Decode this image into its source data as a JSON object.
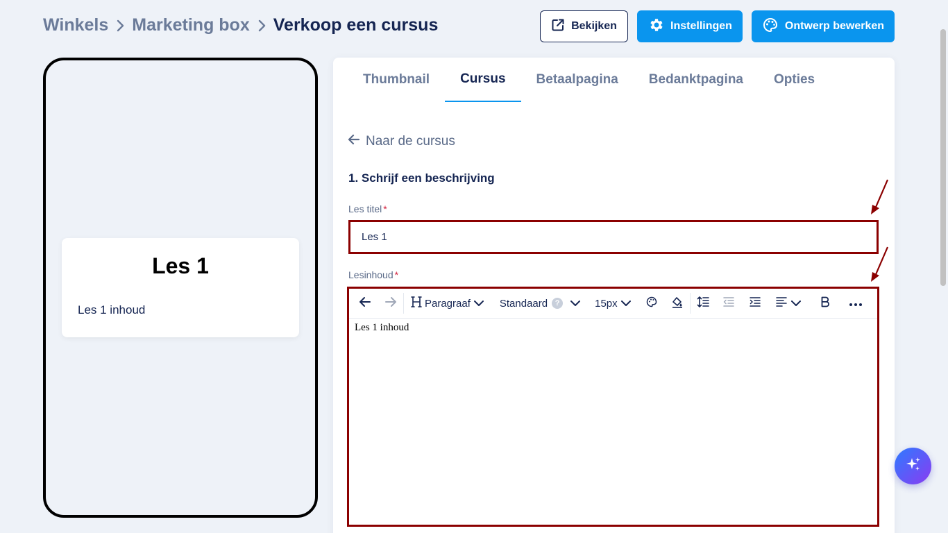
{
  "breadcrumb": {
    "items": [
      "Winkels",
      "Marketing box",
      "Verkoop een cursus"
    ]
  },
  "header": {
    "view_label": "Bekijken",
    "settings_label": "Instellingen",
    "design_label": "Ontwerp bewerken"
  },
  "preview": {
    "title": "Les 1",
    "body": "Les 1 inhoud"
  },
  "tabs": [
    {
      "label": "Thumbnail",
      "active": false
    },
    {
      "label": "Cursus",
      "active": true
    },
    {
      "label": "Betaalpagina",
      "active": false
    },
    {
      "label": "Bedanktpagina",
      "active": false
    },
    {
      "label": "Opties",
      "active": false
    }
  ],
  "form": {
    "back_label": "Naar de cursus",
    "section_title": "1. Schrijf een beschrijving",
    "title_label": "Les titel",
    "title_value": "Les 1",
    "required_mark": "*",
    "content_label": "Lesinhoud",
    "content_value": "Les 1 inhoud"
  },
  "toolbar": {
    "heading_label": "Paragraaf",
    "font_label": "Standaard",
    "help_mark": "?",
    "size_label": "15px"
  },
  "colors": {
    "accent": "#0a95ee",
    "navy": "#152552",
    "highlight_border": "#8b0000",
    "required": "#d21f3c"
  },
  "icons": [
    "chevron-right-icon",
    "external-link-icon",
    "gear-icon",
    "palette-icon",
    "arrow-left-icon",
    "undo-icon",
    "redo-icon",
    "heading-icon",
    "chevron-down-icon",
    "text-color-icon",
    "highlight-icon",
    "line-height-icon",
    "outdent-icon",
    "indent-icon",
    "align-icon",
    "bold-icon",
    "more-icon",
    "sparkle-icon"
  ]
}
